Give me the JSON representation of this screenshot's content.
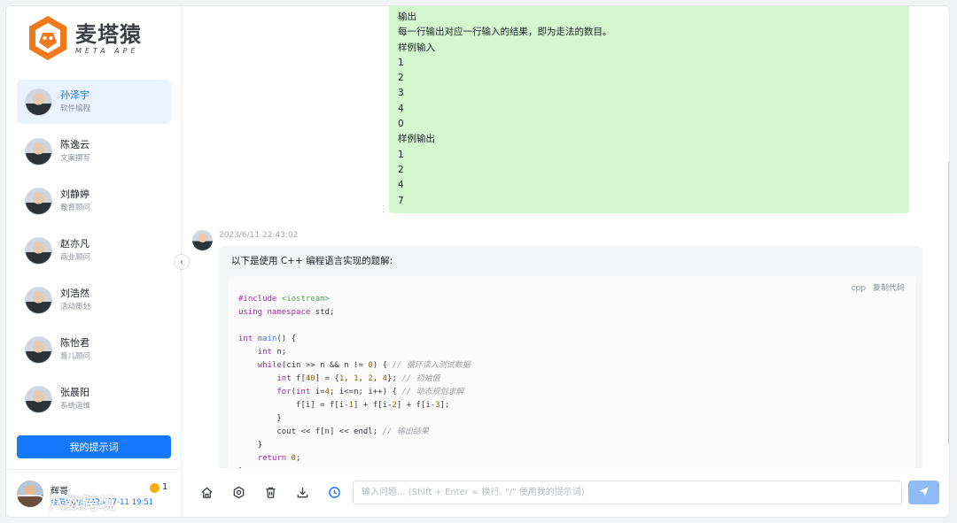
{
  "brand": {
    "name_cn": "麦塔猿",
    "name_en": "META APE"
  },
  "contacts": [
    {
      "name": "孙泽宇",
      "role": "软件编程",
      "active": true
    },
    {
      "name": "陈逸云",
      "role": "文案撰写"
    },
    {
      "name": "刘静婷",
      "role": "教育顾问"
    },
    {
      "name": "赵亦凡",
      "role": "商业顾问"
    },
    {
      "name": "刘浩然",
      "role": "活动策划"
    },
    {
      "name": "陈怡君",
      "role": "育儿顾问"
    },
    {
      "name": "张晨阳",
      "role": "系统运维"
    }
  ],
  "sidebar": {
    "prompt_button": "我的提示词"
  },
  "user": {
    "name": "辉哥",
    "expire": "会员到期: 2023-07-11 19:51",
    "coins": "1"
  },
  "watermark": "八数跨境",
  "question_tail": {
    "lines": [
      "输出",
      "每一行输出对应一行输入的结果，即为走法的数目。",
      "样例输入",
      "1",
      "2",
      "3",
      "4",
      "0",
      "样例输出",
      "1",
      "2",
      "4",
      "7"
    ]
  },
  "answer": {
    "time": "2023/6/11 22:43:02",
    "intro": "以下是使用 C++ 编程语言实现的题解:",
    "code_lang": "cpp",
    "copy_label": "复制代码",
    "comments": {
      "loop": "// 循环读入测试数据",
      "init": "// 初始值",
      "dp": "// 动态规划求解",
      "out": "// 输出结果"
    }
  },
  "input": {
    "placeholder": "输入问题... (Shift + Enter = 换行, \"/\" 使用我的提示词)"
  },
  "colors": {
    "accent": "#1677ff",
    "user_bubble": "#d4f7d0"
  }
}
